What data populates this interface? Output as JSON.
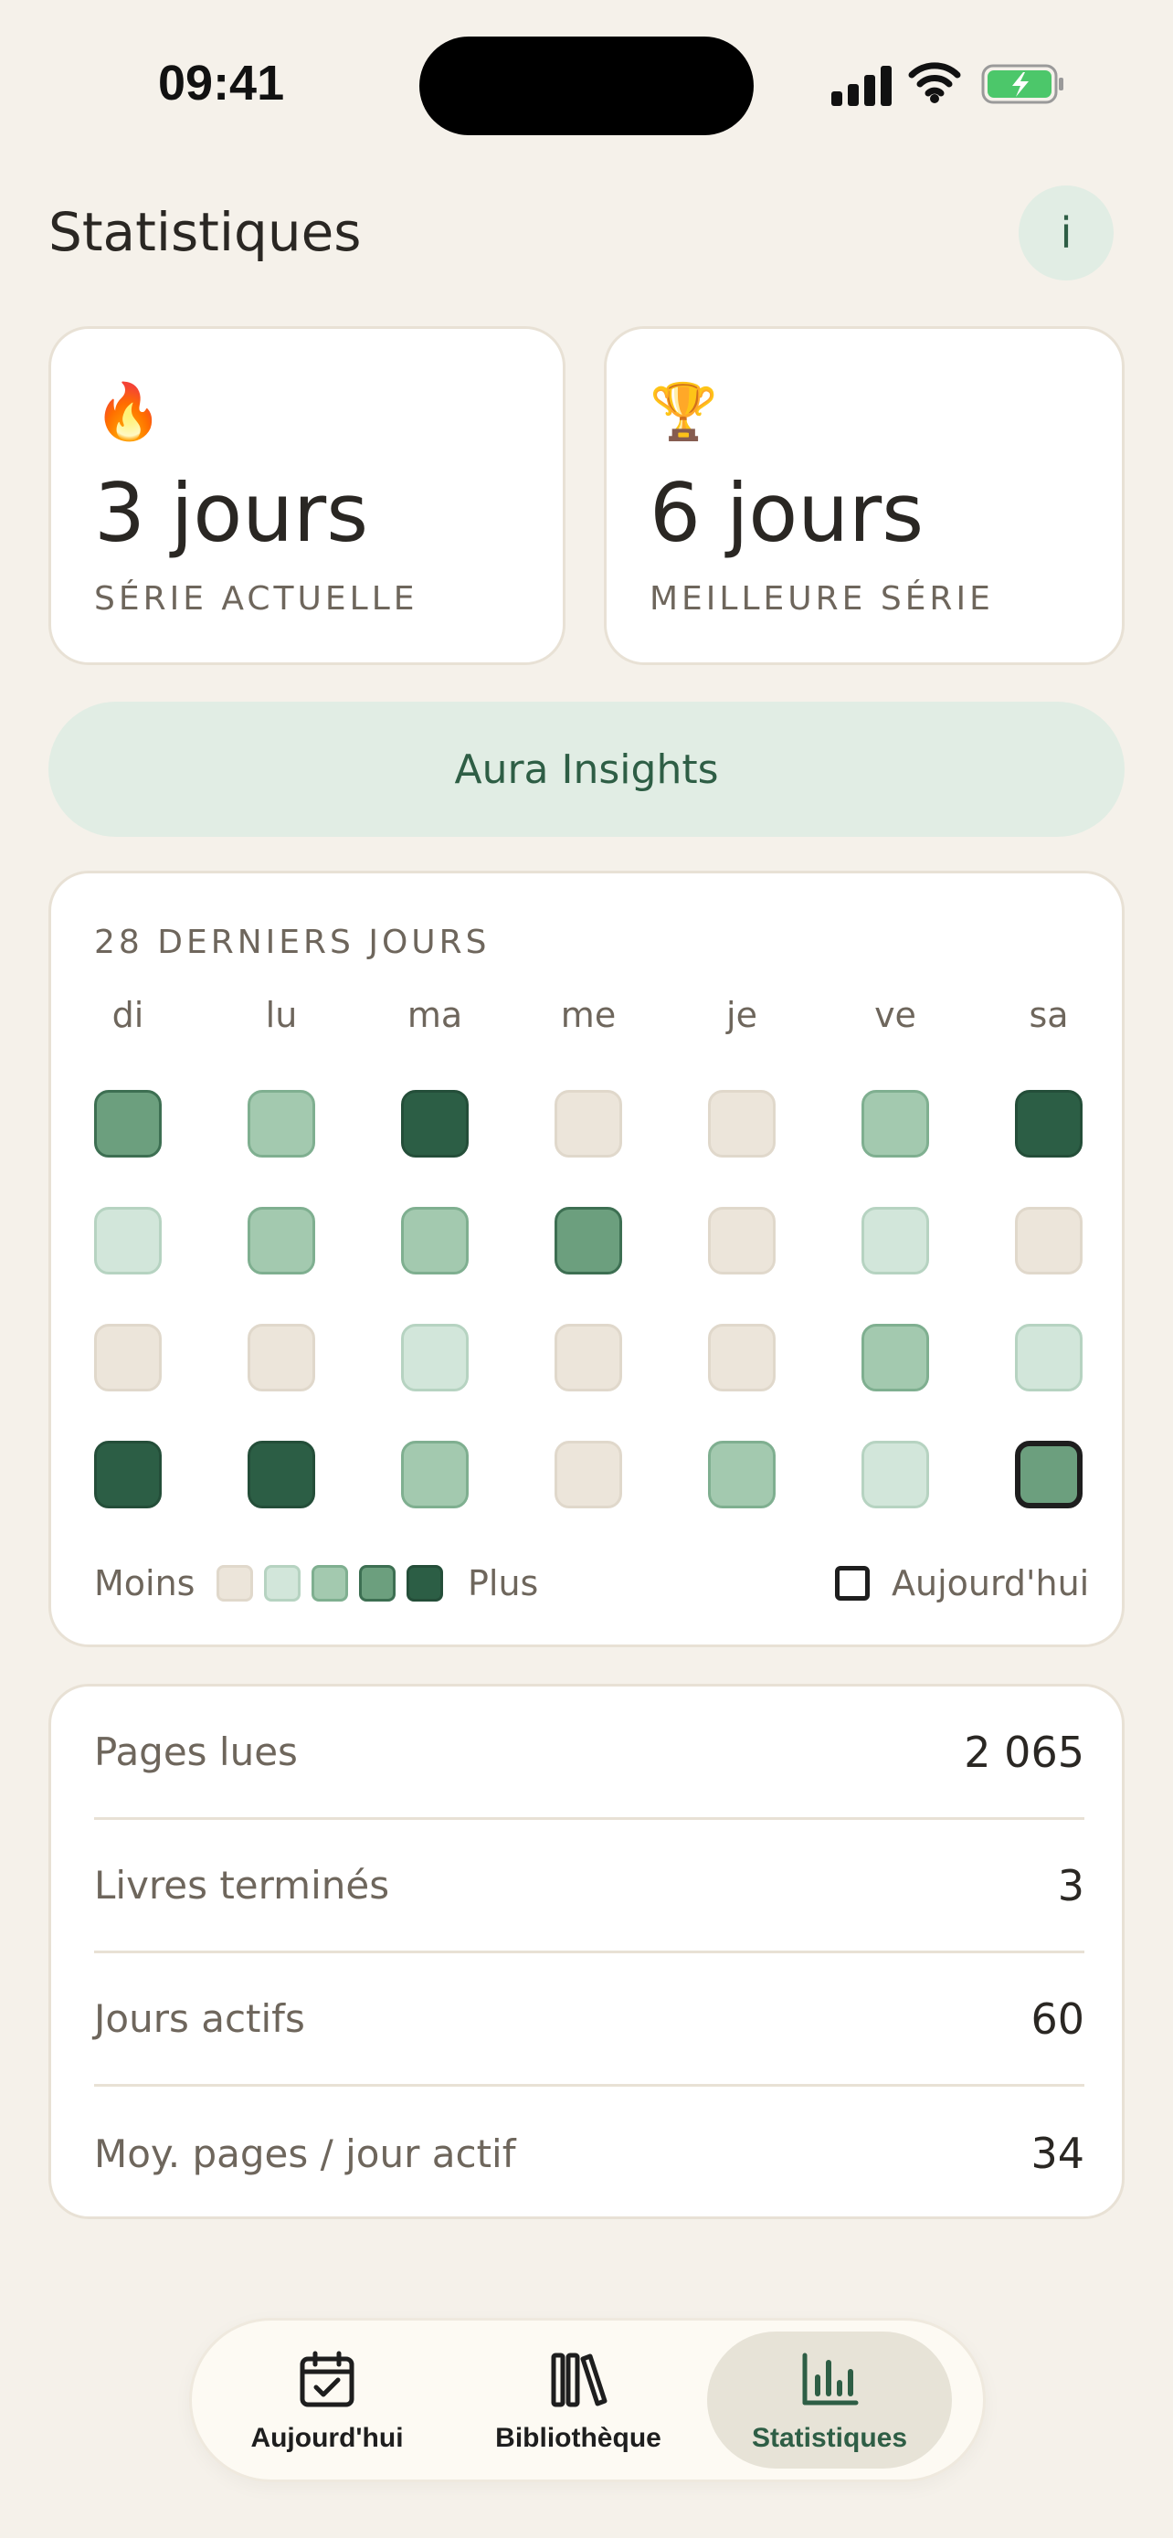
{
  "status_bar": {
    "time": "09:41"
  },
  "header": {
    "title": "Statistiques",
    "info_label": "i"
  },
  "streaks": {
    "current": {
      "emoji": "🔥",
      "value": "3 jours",
      "label": "SÉRIE ACTUELLE"
    },
    "best": {
      "emoji": "🏆",
      "value": "6 jours",
      "label": "MEILLEURE SÉRIE"
    }
  },
  "insights_label": "Aura Insights",
  "heatmap": {
    "title": "28 DERNIERS JOURS",
    "weekdays": [
      "di",
      "lu",
      "ma",
      "me",
      "je",
      "ve",
      "sa"
    ],
    "levels": [
      [
        3,
        2,
        4,
        0,
        0,
        2,
        4
      ],
      [
        1,
        2,
        2,
        3,
        0,
        1,
        0
      ],
      [
        0,
        0,
        1,
        0,
        0,
        2,
        1
      ],
      [
        4,
        4,
        2,
        0,
        2,
        1,
        3
      ]
    ],
    "today": {
      "row": 3,
      "col": 6
    },
    "legend_less": "Moins",
    "legend_more": "Plus",
    "legend_today": "Aujourd'hui",
    "colors": [
      "#ECE5DA",
      "#D2E6DA",
      "#A3C9AF",
      "#6C9F7E",
      "#2C5E45"
    ]
  },
  "stats": [
    {
      "label": "Pages lues",
      "value": "2 065"
    },
    {
      "label": "Livres terminés",
      "value": "3"
    },
    {
      "label": "Jours actifs",
      "value": "60"
    },
    {
      "label": "Moy. pages / jour actif",
      "value": "34"
    }
  ],
  "tabs": [
    {
      "label": "Aujourd'hui",
      "icon": "calendar-check-icon",
      "active": false
    },
    {
      "label": "Bibliothèque",
      "icon": "books-icon",
      "active": false
    },
    {
      "label": "Statistiques",
      "icon": "bar-chart-icon",
      "active": true
    }
  ],
  "accent_color": "#2E5E45"
}
